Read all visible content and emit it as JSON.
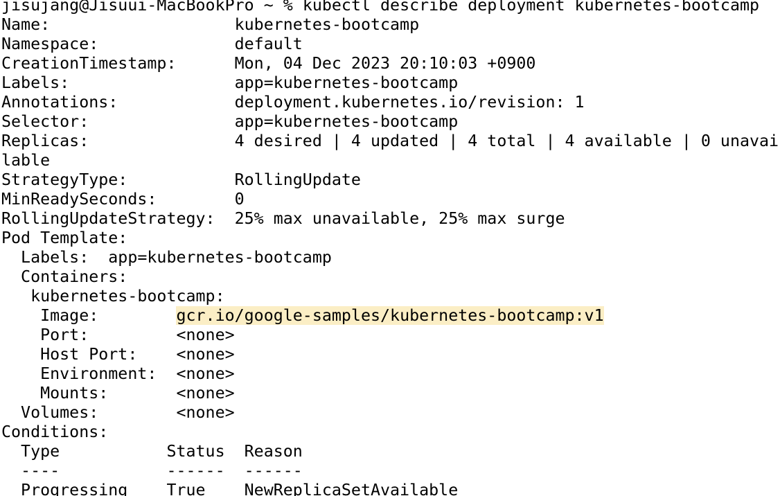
{
  "terminal": {
    "prompt": "jisujang@Jisuui-MacBookPro ~ % ",
    "command": "kubectl describe deployment kubernetes-bootcamp",
    "rows": [
      "Name:                   kubernetes-bootcamp",
      "Namespace:              default",
      "CreationTimestamp:      Mon, 04 Dec 2023 20:10:03 +0900",
      "Labels:                 app=kubernetes-bootcamp",
      "Annotations:            deployment.kubernetes.io/revision: 1",
      "Selector:               app=kubernetes-bootcamp",
      "Replicas:               4 desired | 4 updated | 4 total | 4 available | 0 unavai",
      "lable",
      "StrategyType:           RollingUpdate",
      "MinReadySeconds:        0",
      "RollingUpdateStrategy:  25% max unavailable, 25% max surge",
      "Pod Template:",
      "  Labels:  app=kubernetes-bootcamp",
      "  Containers:",
      "   kubernetes-bootcamp:"
    ],
    "image_label": "    Image:        ",
    "image_value": "gcr.io/google-samples/kubernetes-bootcamp:v1",
    "rows_after": [
      "    Port:         <none>",
      "    Host Port:    <none>",
      "    Environment:  <none>",
      "    Mounts:       <none>",
      "  Volumes:        <none>",
      "Conditions:",
      "  Type           Status  Reason",
      "  ----           ------  ------",
      "  Progressing    True    NewReplicaSetAvailable"
    ]
  }
}
